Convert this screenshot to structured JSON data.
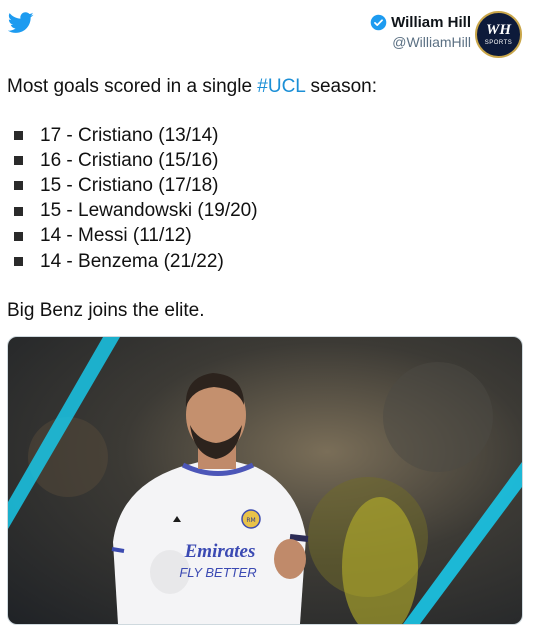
{
  "tweet": {
    "author_name": "William Hill",
    "author_handle": "@WilliamHill",
    "avatar_text": "WH",
    "avatar_subtext": "SPORTS",
    "intro_prefix": "Most goals scored in a single ",
    "hashtag": "#UCL",
    "intro_suffix": " season:",
    "list": [
      "17 - Cristiano (13/14)",
      "16 - Cristiano (15/16)",
      "15 - Cristiano (17/18)",
      "15 - Lewandowski (19/20)",
      "14 - Messi (11/12)",
      "14 - Benzema (21/22)"
    ],
    "closing": "Big Benz joins the elite.",
    "image": {
      "shirt_sponsor_line1": "Emirates",
      "shirt_sponsor_line2": "FLY BETTER",
      "badge_text": "RM"
    }
  },
  "colors": {
    "twitter_blue": "#1d9bf0",
    "hashtag": "#1b8fd6",
    "avatar_bg": "#0d1a3a",
    "avatar_ring": "#c9a64a",
    "stripe_cyan": "#19c7e8"
  },
  "icons": [
    "twitter-bird-icon",
    "verified-badge-icon",
    "list-bullet-icon"
  ]
}
